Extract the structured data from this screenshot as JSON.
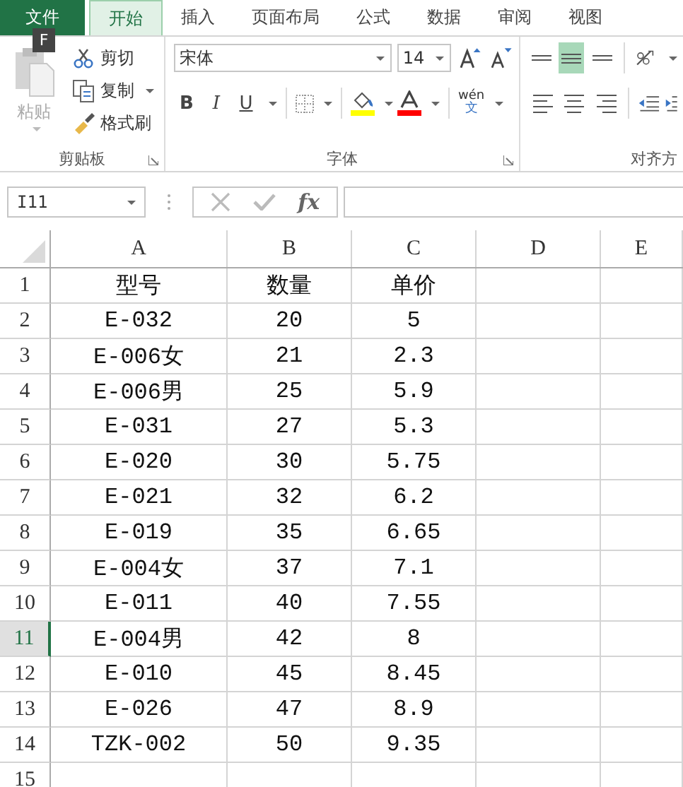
{
  "tabs": [
    {
      "label": "文件",
      "kind": "file",
      "selected": false
    },
    {
      "label": "开始",
      "kind": "tab",
      "selected": true
    },
    {
      "label": "插入",
      "kind": "tab",
      "selected": false
    },
    {
      "label": "页面布局",
      "kind": "tab",
      "selected": false
    },
    {
      "label": "公式",
      "kind": "tab",
      "selected": false
    },
    {
      "label": "数据",
      "kind": "tab",
      "selected": false
    },
    {
      "label": "审阅",
      "kind": "tab",
      "selected": false
    },
    {
      "label": "视图",
      "kind": "tab",
      "selected": false
    }
  ],
  "keytip": "F",
  "clipboard": {
    "paste_label": "粘贴",
    "group_label": "剪贴板",
    "items": [
      {
        "kind": "cut",
        "label": "剪切"
      },
      {
        "kind": "copy",
        "label": "复制"
      },
      {
        "kind": "brush",
        "label": "格式刷"
      }
    ]
  },
  "font": {
    "name": "宋体",
    "size": "14",
    "group_label": "字体",
    "styles": [
      {
        "kind": "bold",
        "label": "B"
      },
      {
        "kind": "italic",
        "label": "I"
      },
      {
        "kind": "underline",
        "label": "U"
      }
    ],
    "phonetic_top": "wén",
    "phonetic_bottom": "文"
  },
  "alignment": {
    "group_label": "对齐方",
    "buttons": [
      {
        "kind": "top",
        "selected": false
      },
      {
        "kind": "middle",
        "selected": true
      },
      {
        "kind": "bottom",
        "selected": false
      },
      {
        "kind": "left",
        "selected": false
      },
      {
        "kind": "center",
        "selected": false
      },
      {
        "kind": "right",
        "selected": false
      }
    ]
  },
  "name_box": "I11",
  "fx_label": "fx",
  "columns": [
    "A",
    "B",
    "C",
    "D",
    "E"
  ],
  "rows": [
    {
      "number": "1",
      "selected": false,
      "cells": [
        "型号",
        "数量",
        "单价"
      ]
    },
    {
      "number": "2",
      "selected": false,
      "cells": [
        "E-032",
        "20",
        "5"
      ]
    },
    {
      "number": "3",
      "selected": false,
      "cells": [
        "E-006女",
        "21",
        "2.3"
      ]
    },
    {
      "number": "4",
      "selected": false,
      "cells": [
        "E-006男",
        "25",
        "5.9"
      ]
    },
    {
      "number": "5",
      "selected": false,
      "cells": [
        "E-031",
        "27",
        "5.3"
      ]
    },
    {
      "number": "6",
      "selected": false,
      "cells": [
        "E-020",
        "30",
        "5.75"
      ]
    },
    {
      "number": "7",
      "selected": false,
      "cells": [
        "E-021",
        "32",
        "6.2"
      ]
    },
    {
      "number": "8",
      "selected": false,
      "cells": [
        "E-019",
        "35",
        "6.65"
      ]
    },
    {
      "number": "9",
      "selected": false,
      "cells": [
        "E-004女",
        "37",
        "7.1"
      ]
    },
    {
      "number": "10",
      "selected": false,
      "cells": [
        "E-011",
        "40",
        "7.55"
      ]
    },
    {
      "number": "11",
      "selected": true,
      "cells": [
        "E-004男",
        "42",
        "8"
      ]
    },
    {
      "number": "12",
      "selected": false,
      "cells": [
        "E-010",
        "45",
        "8.45"
      ]
    },
    {
      "number": "13",
      "selected": false,
      "cells": [
        "E-026",
        "47",
        "8.9"
      ]
    },
    {
      "number": "14",
      "selected": false,
      "cells": [
        "TZK-002",
        "50",
        "9.35"
      ]
    },
    {
      "number": "15",
      "selected": false,
      "cells": []
    }
  ]
}
